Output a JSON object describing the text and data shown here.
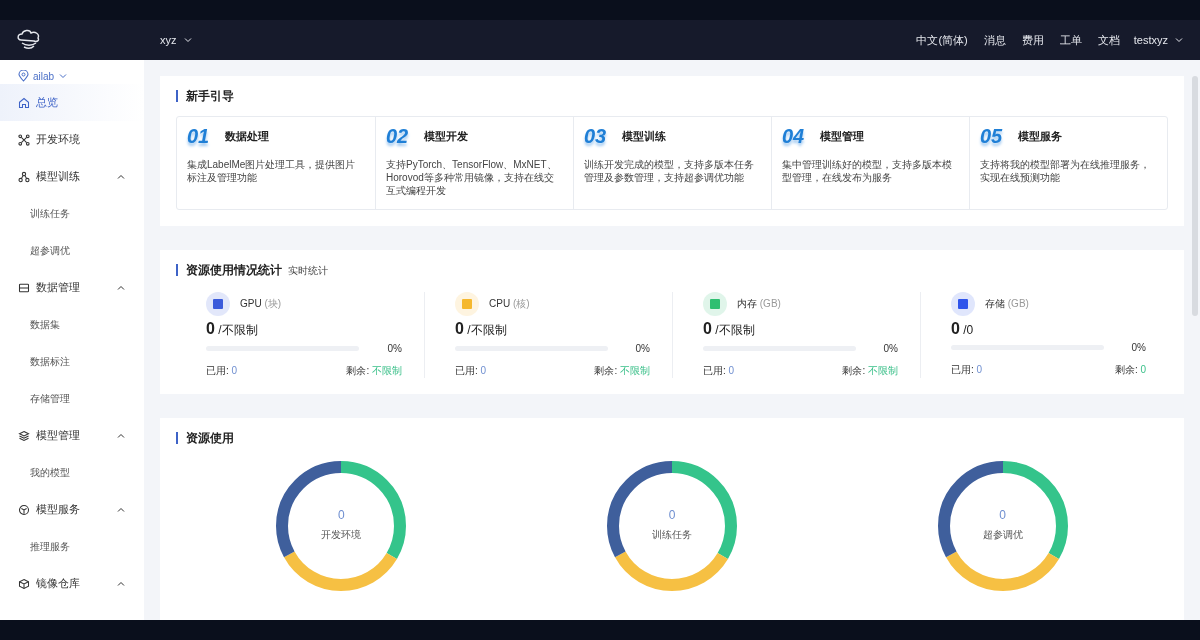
{
  "header": {
    "workspace": "xyz",
    "links": [
      "中文(简体)",
      "消息",
      "费用",
      "工单",
      "文档"
    ],
    "user": "testxyz"
  },
  "sidebar": {
    "location": "ailab",
    "items": [
      {
        "label": "总览",
        "selected": true
      },
      {
        "label": "开发环境",
        "selected": false
      },
      {
        "label": "模型训练",
        "selected": false,
        "expanded": true,
        "children": [
          {
            "label": "训练任务",
            "selected": false
          },
          {
            "label": "超参调优",
            "selected": false
          }
        ]
      },
      {
        "label": "数据管理",
        "selected": false,
        "expanded": true,
        "children": [
          {
            "label": "数据集",
            "selected": false
          },
          {
            "label": "数据标注",
            "selected": false
          },
          {
            "label": "存储管理",
            "selected": false
          }
        ]
      },
      {
        "label": "模型管理",
        "selected": false,
        "expanded": true,
        "children": [
          {
            "label": "我的模型",
            "selected": false
          }
        ]
      },
      {
        "label": "模型服务",
        "selected": false,
        "expanded": true,
        "children": [
          {
            "label": "推理服务",
            "selected": false
          }
        ]
      },
      {
        "label": "镜像仓库",
        "selected": false,
        "expanded": true
      }
    ]
  },
  "guide": {
    "title": "新手引导",
    "steps": [
      {
        "number": "01",
        "title": "数据处理",
        "description": "集成LabelMe图片处理工具，提供图片标注及管理功能"
      },
      {
        "number": "02",
        "title": "模型开发",
        "description": "支持PyTorch、TensorFlow、MxNET、Horovod等多种常用镜像，支持在线交互式编程开发"
      },
      {
        "number": "03",
        "title": "模型训练",
        "description": "训练开发完成的模型，支持多版本任务管理及参数管理，支持超参调优功能"
      },
      {
        "number": "04",
        "title": "模型管理",
        "description": "集中管理训练好的模型，支持多版本模型管理，在线发布为服务"
      },
      {
        "number": "05",
        "title": "模型服务",
        "description": "支持将我的模型部署为在线推理服务，实现在线预测功能"
      }
    ]
  },
  "stats": {
    "title": "资源使用情况统计",
    "subtitle": "实时统计",
    "resources": [
      {
        "name": "GPU",
        "unit": "(块)",
        "color": "#3b5bdb",
        "value": "0",
        "limit": "/不限制",
        "level": 0,
        "percent": "0%",
        "used_label": "已用:",
        "used": "0",
        "remain_label": "剩余:",
        "remain": "不限制"
      },
      {
        "name": "CPU",
        "unit": "(核)",
        "color": "#f5b82e",
        "value": "0",
        "limit": "/不限制",
        "level": 0,
        "percent": "0%",
        "used_label": "已用:",
        "used": "0",
        "remain_label": "剩余:",
        "remain": "不限制"
      },
      {
        "name": "内存",
        "unit": "(GB)",
        "color": "#2fbf71",
        "value": "0",
        "limit": "/不限制",
        "level": 0,
        "percent": "0%",
        "used_label": "已用:",
        "used": "0",
        "remain_label": "剩余:",
        "remain": "不限制"
      },
      {
        "name": "存储",
        "unit": "(GB)",
        "color": "#2f54eb",
        "value": "0",
        "limit": "/0",
        "level": 0,
        "percent": "0%",
        "used_label": "已用:",
        "used": "0",
        "remain_label": "剩余:",
        "remain": "0"
      }
    ]
  },
  "usage": {
    "title": "资源使用",
    "donuts": [
      {
        "value": "0",
        "label": "开发环境"
      },
      {
        "value": "0",
        "label": "训练任务"
      },
      {
        "value": "0",
        "label": "超参调优"
      }
    ]
  }
}
